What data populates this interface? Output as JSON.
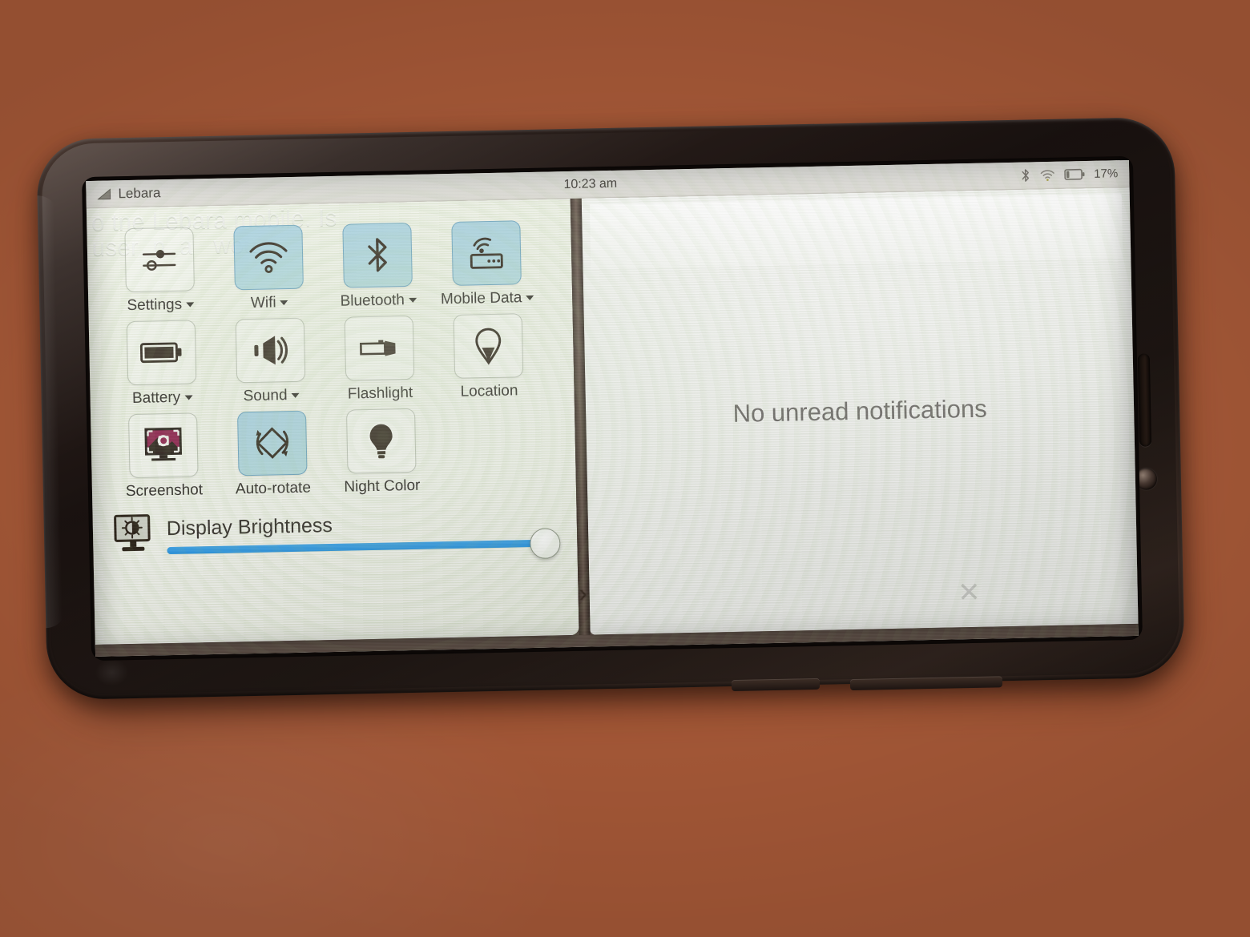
{
  "device": {
    "frame_color": "#241a16",
    "surface": "wood-table"
  },
  "status_bar": {
    "signal_icon": "signal-triangle-icon",
    "carrier": "Lebara",
    "clock": "10:23 am",
    "bluetooth_icon": "bluetooth-icon",
    "wifi_icon": "wifi-icon",
    "battery_icon": "battery-icon",
    "battery_percent": "17%"
  },
  "quick_settings": {
    "background_ghost_text": "o tne Lebara mobile. Is\nuser  n  a   woul",
    "tiles": [
      {
        "label": "Settings",
        "icon": "sliders-icon",
        "active": false,
        "has_menu": true
      },
      {
        "label": "Wifi",
        "icon": "wifi-icon",
        "active": true,
        "has_menu": true
      },
      {
        "label": "Bluetooth",
        "icon": "bluetooth-icon",
        "active": true,
        "has_menu": true
      },
      {
        "label": "Mobile Data",
        "icon": "router-icon",
        "active": true,
        "has_menu": true
      },
      {
        "label": "Battery",
        "icon": "battery-icon",
        "active": false,
        "has_menu": true
      },
      {
        "label": "Sound",
        "icon": "speaker-icon",
        "active": false,
        "has_menu": true
      },
      {
        "label": "Flashlight",
        "icon": "flashlight-icon",
        "active": false,
        "has_menu": false
      },
      {
        "label": "Location",
        "icon": "map-pin-icon",
        "active": false,
        "has_menu": false
      },
      {
        "label": "Screenshot",
        "icon": "screenshot-icon",
        "active": false,
        "has_menu": false
      },
      {
        "label": "Auto-rotate",
        "icon": "rotate-icon",
        "active": true,
        "has_menu": false
      },
      {
        "label": "Night Color",
        "icon": "lightbulb-icon",
        "active": false,
        "has_menu": false
      }
    ],
    "brightness": {
      "icon": "display-brightness-icon",
      "label": "Display Brightness",
      "value": 97,
      "fill_color": "#2b95e0"
    },
    "expand_chevron": "chevron-right-icon"
  },
  "notifications": {
    "empty_text": "No unread notifications",
    "clear_icon": "close-x-icon"
  },
  "colors": {
    "accent_blue": "#2b95e0",
    "tile_active": "#96c8e1",
    "panel_bg": "#eef1e5",
    "status_bar_bg": "#ebebe6",
    "text_primary": "#2e2b27",
    "text_muted": "#6e6c68"
  }
}
